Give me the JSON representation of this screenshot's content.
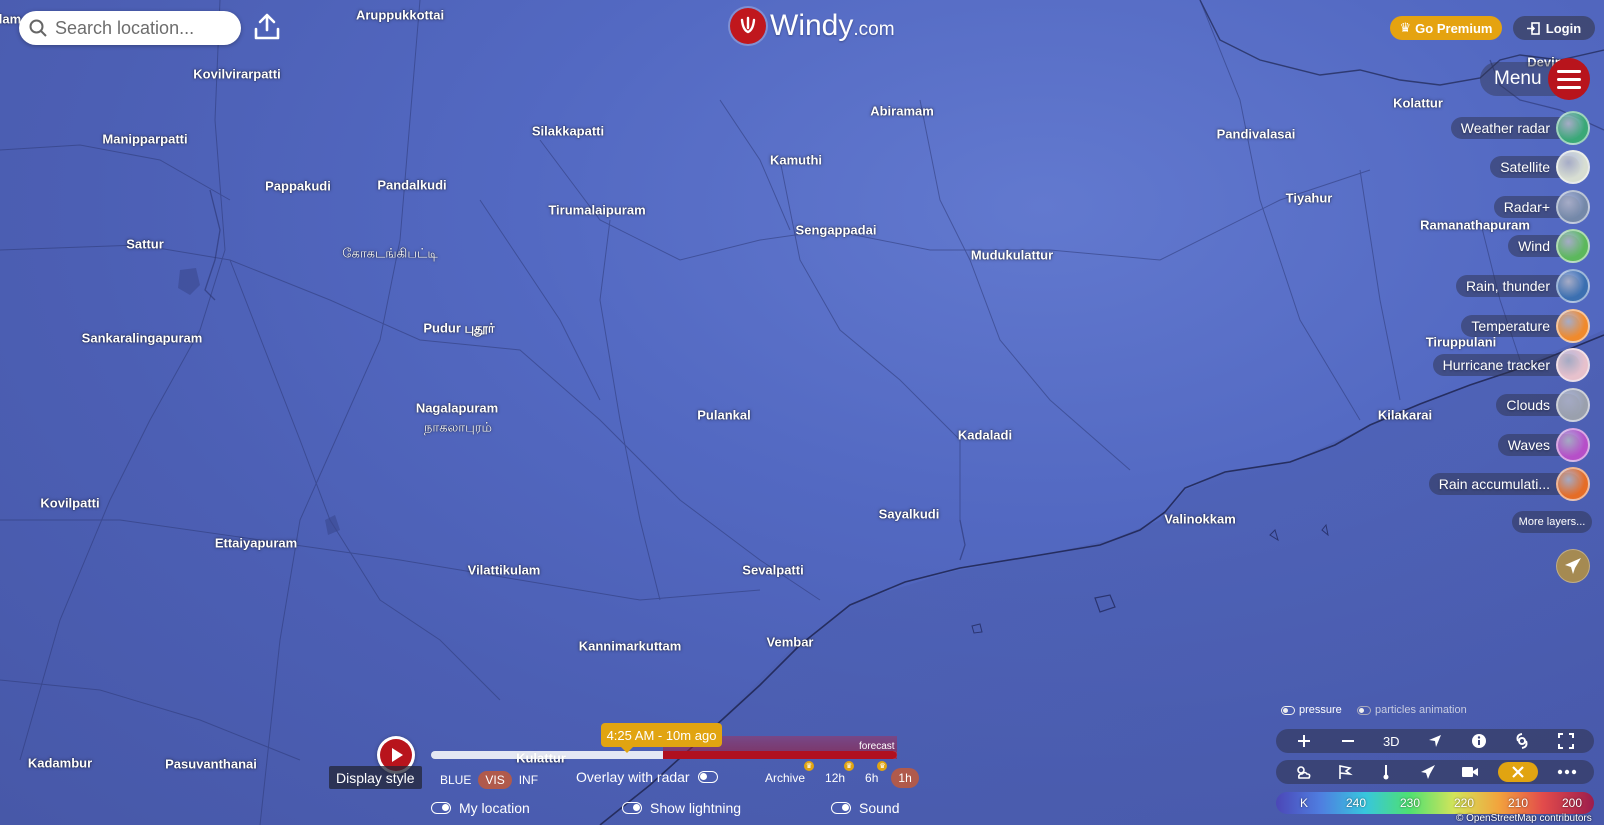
{
  "search": {
    "placeholder": "Search location..."
  },
  "logo": {
    "name": "Windy",
    "suffix": ".com"
  },
  "header": {
    "premium_label": "Go Premium",
    "login_label": "Login",
    "menu_label": "Menu"
  },
  "layers": [
    {
      "label": "Weather radar",
      "thumb": "#3aa877"
    },
    {
      "label": "Satellite",
      "thumb": "#d8ded2"
    },
    {
      "label": "Radar+",
      "thumb": "#7488a8"
    },
    {
      "label": "Wind",
      "thumb": "#5cb85c"
    },
    {
      "label": "Rain, thunder",
      "thumb": "#3b6fb0"
    },
    {
      "label": "Temperature",
      "thumb": "#f08a2c"
    },
    {
      "label": "Hurricane tracker",
      "thumb": "#e7c1cc"
    },
    {
      "label": "Clouds",
      "thumb": "#9aa0ad"
    },
    {
      "label": "Waves",
      "thumb": "#b64fc8"
    },
    {
      "label": "Rain accumulati...",
      "thumb": "#e56d27"
    }
  ],
  "more_layers_label": "More layers...",
  "map_options": {
    "pressure_label": "pressure",
    "particles_label": "particles animation"
  },
  "legend": {
    "unit": "K",
    "values": [
      "240",
      "230",
      "220",
      "210",
      "200"
    ]
  },
  "attribution": "© OpenStreetMap contributors",
  "timeline": {
    "time_label": "4:25 AM - 10m ago",
    "forecast_label": "forecast",
    "display_style_label": "Display style",
    "modes": [
      "BLUE",
      "VIS",
      "INF"
    ],
    "active_mode": "VIS",
    "overlay_label": "Overlay with radar",
    "archive_label": "Archive",
    "archive_options": [
      "12h",
      "6h",
      "1h"
    ],
    "my_location_label": "My location",
    "show_lightning_label": "Show lightning",
    "sound_label": "Sound"
  },
  "places": [
    {
      "name": "Aruppukkottai",
      "bold": true
    },
    {
      "name": "Kovilvirarpatti",
      "bold": true
    },
    {
      "name": "Manipparpatti",
      "bold": true
    },
    {
      "name": "Pappakudi",
      "bold": true
    },
    {
      "name": "Pandalkudi",
      "bold": true
    },
    {
      "name": "Sattur",
      "bold": true
    },
    {
      "name": "கோகடங்கிபட்டி",
      "bold": false
    },
    {
      "name": "Sankaralingapuram",
      "bold": true
    },
    {
      "name": "Pudur புதூர்",
      "bold": true
    },
    {
      "name": "Nagalapuram",
      "bold": true
    },
    {
      "name": "நாகலாபுரம்",
      "bold": false
    },
    {
      "name": "Kovilpatti",
      "bold": true
    },
    {
      "name": "Ettaiyapuram",
      "bold": true
    },
    {
      "name": "Vilattikulam",
      "bold": true
    },
    {
      "name": "Kadambur",
      "bold": true
    },
    {
      "name": "Pasuvanthanai",
      "bold": true
    },
    {
      "name": "Kulattur",
      "bold": true
    },
    {
      "name": "Silakkapatti",
      "bold": true
    },
    {
      "name": "Tirumalaipuram",
      "bold": true
    },
    {
      "name": "Kamuthi",
      "bold": true
    },
    {
      "name": "Abiramam",
      "bold": true
    },
    {
      "name": "Sengappadai",
      "bold": true
    },
    {
      "name": "Mudukulattur",
      "bold": true
    },
    {
      "name": "Pulankal",
      "bold": true
    },
    {
      "name": "Kadaladi",
      "bold": true
    },
    {
      "name": "Sayalkudi",
      "bold": true
    },
    {
      "name": "Sevalpatti",
      "bold": true
    },
    {
      "name": "Kannimarkuttam",
      "bold": true
    },
    {
      "name": "Vembar",
      "bold": true
    },
    {
      "name": "Valinokkam",
      "bold": true
    },
    {
      "name": "Pandivalasai",
      "bold": true
    },
    {
      "name": "Kolattur",
      "bold": true
    },
    {
      "name": "Tiyahur",
      "bold": true
    },
    {
      "name": "Ramanathapuram",
      "bold": true
    },
    {
      "name": "Tiruppulani",
      "bold": true
    },
    {
      "name": "Kilakarai",
      "bold": true
    },
    {
      "name": "Devip",
      "bold": true
    },
    {
      "name": "lam",
      "bold": true
    }
  ]
}
